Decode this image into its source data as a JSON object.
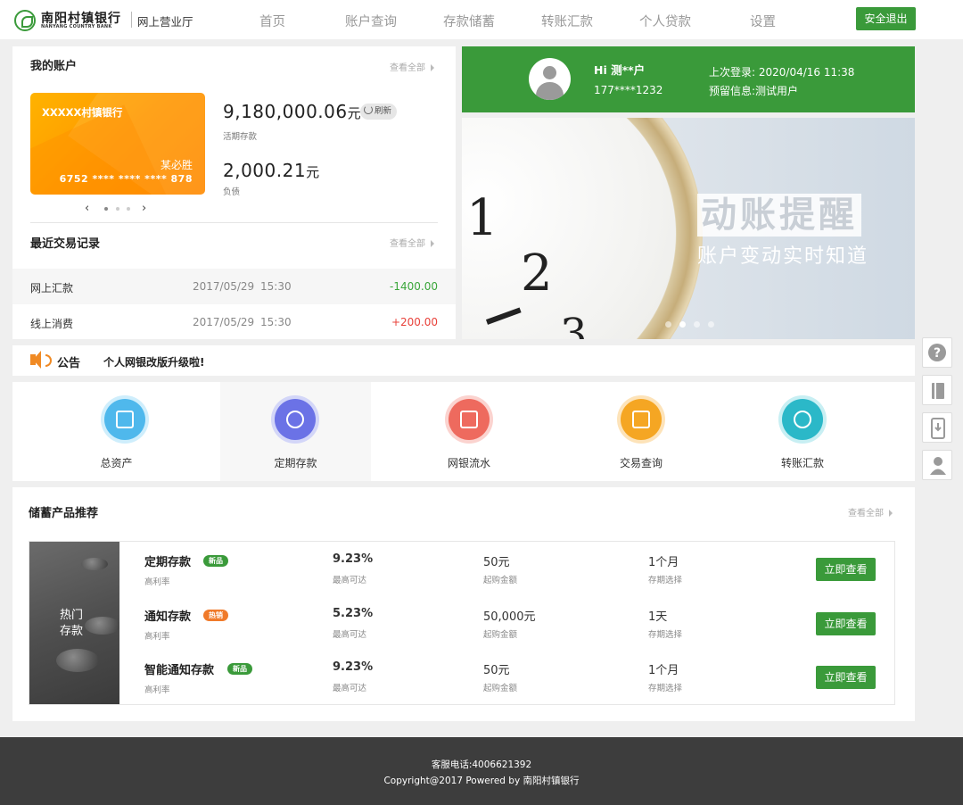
{
  "header": {
    "logo_cn": "南阳村镇银行",
    "logo_en": "NANYANG COUNTRY BANK",
    "subtitle": "网上营业厅",
    "nav": [
      "首页",
      "账户查询",
      "存款储蓄",
      "转账汇款",
      "个人贷款",
      "设置"
    ],
    "logout_label": "安全退出"
  },
  "account": {
    "title": "我的账户",
    "more_label": "查看全部",
    "card": {
      "bank_name": "XXXXX村镇银行",
      "holder": "某必胜",
      "number": "6752 **** **** **** 878"
    },
    "balances": [
      {
        "amount": "9,180,000.06",
        "unit": "元",
        "label": "活期存款"
      },
      {
        "amount": "2,000.21",
        "unit": "元",
        "label": "负债"
      }
    ],
    "refresh_label": "刷新",
    "carousel_prev": "‹",
    "carousel_next": "›"
  },
  "transactions": {
    "title": "最近交易记录",
    "more_label": "查看全部",
    "rows": [
      {
        "name": "网上汇款",
        "date": "2017/05/29",
        "time": "15:30",
        "amount": "-1400.00",
        "color": "#3aa63a"
      },
      {
        "name": "线上消费",
        "date": "2017/05/29",
        "time": "15:30",
        "amount": "+200.00",
        "color": "#e8413a"
      }
    ]
  },
  "user": {
    "greeting": "Hi 测**户",
    "phone": "177****1232",
    "last_login": "上次登录: 2020/04/16 11:38",
    "reserved_info": "预留信息:测试用户"
  },
  "promo": {
    "title": "动账提醒",
    "subtitle": "账户变动实时知道",
    "clock_numbers": [
      "1",
      "2",
      "3"
    ]
  },
  "notice": {
    "label": "公告",
    "text": "个人网银改版升级啦!"
  },
  "quick_menu": [
    {
      "label": "总资产",
      "icon": "wallet-icon",
      "color": "#4fb8ec"
    },
    {
      "label": "定期存款",
      "icon": "piggy-bank-icon",
      "color": "#6b72e6"
    },
    {
      "label": "网银流水",
      "icon": "ledger-icon",
      "color": "#ee6a5e"
    },
    {
      "label": "交易查询",
      "icon": "receipt-icon",
      "color": "#f5a623"
    },
    {
      "label": "转账汇款",
      "icon": "transfer-icon",
      "color": "#2bb8c8"
    }
  ],
  "products": {
    "title": "储蓄产品推荐",
    "more_label": "查看全部",
    "image_text_line1": "热门",
    "image_text_line2": "存款",
    "labels": {
      "rate": "高利率",
      "max_rate": "最高可达",
      "min_amount": "起购金额",
      "term": "存期选择"
    },
    "button_label": "立即查看",
    "items": [
      {
        "name": "定期存款",
        "tag": "新品",
        "tag_color": "#3a9a3a",
        "rate": "9.23%",
        "amount": "50元",
        "term": "1个月"
      },
      {
        "name": "通知存款",
        "tag": "热销",
        "tag_color": "#f07a2a",
        "rate": "5.23%",
        "amount": "50,000元",
        "term": "1天"
      },
      {
        "name": "智能通知存款",
        "tag": "新品",
        "tag_color": "#3a9a3a",
        "rate": "9.23%",
        "amount": "50元",
        "term": "1个月"
      }
    ]
  },
  "side_tools": [
    "help-icon",
    "book-icon",
    "mobile-download-icon",
    "user-icon"
  ],
  "footer": {
    "hotline": "客服电话:4006621392",
    "copyright": "Copyright@2017 Powered by 南阳村镇银行"
  }
}
